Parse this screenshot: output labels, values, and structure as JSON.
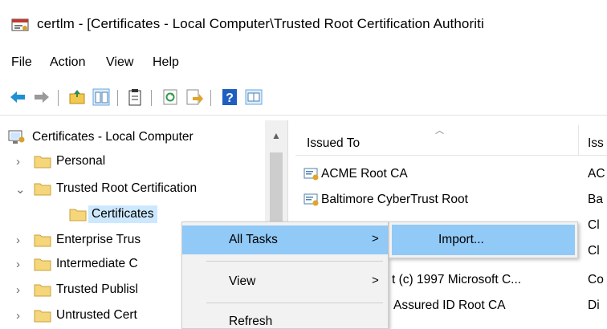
{
  "window": {
    "title": "certlm - [Certificates - Local Computer\\Trusted Root Certification Authoriti",
    "icon": "certificate-manager-icon"
  },
  "menubar": {
    "items": [
      "File",
      "Action",
      "View",
      "Help"
    ]
  },
  "toolbar": {
    "buttons": [
      "back-icon",
      "forward-icon",
      "up-folder-icon",
      "show-hide-tree-icon",
      "clipboard-icon",
      "refresh-icon",
      "export-list-icon",
      "help-icon",
      "properties-icon"
    ]
  },
  "tree": {
    "items": [
      {
        "label": "Certificates - Local Computer",
        "expanded": true,
        "level": 0
      },
      {
        "label": "Personal",
        "expanded": false,
        "level": 1
      },
      {
        "label": "Trusted Root Certification",
        "expanded": true,
        "level": 1
      },
      {
        "label": "Certificates",
        "expanded": false,
        "level": 2,
        "selected": true
      },
      {
        "label": "Enterprise Trus",
        "expanded": false,
        "level": 1
      },
      {
        "label": "Intermediate C",
        "expanded": false,
        "level": 1
      },
      {
        "label": "Trusted Publisl",
        "expanded": false,
        "level": 1
      },
      {
        "label": "Untrusted Cert",
        "expanded": false,
        "level": 1
      }
    ]
  },
  "list": {
    "columns": [
      "Issued To",
      "Iss"
    ],
    "rows": [
      {
        "issued_to": "ACME Root CA",
        "issued_by": "AC"
      },
      {
        "issued_to": "Baltimore CyberTrust Root",
        "issued_by": "Ba"
      },
      {
        "issued_to": "",
        "issued_by": "Cl"
      },
      {
        "issued_to": "",
        "issued_by": "Cl"
      },
      {
        "issued_to": "t (c) 1997 Microsoft C...",
        "issued_by": "Co"
      },
      {
        "issued_to": "Assured ID Root CA",
        "issued_by": "Di"
      }
    ]
  },
  "context_menu": {
    "items": [
      {
        "label": "All Tasks",
        "submenu": true,
        "active": true
      },
      {
        "label": "View",
        "submenu": true,
        "active": false
      },
      {
        "label": "Refresh",
        "submenu": false,
        "active": false
      }
    ],
    "submenu_arrow": ">"
  },
  "submenu": {
    "items": [
      {
        "label": "Import...",
        "active": true
      }
    ]
  },
  "colors": {
    "highlight": "#91c9f7",
    "tree_selection": "#cce8ff",
    "menu_bg": "#f2f2f2",
    "folder": "#f5d67a"
  }
}
